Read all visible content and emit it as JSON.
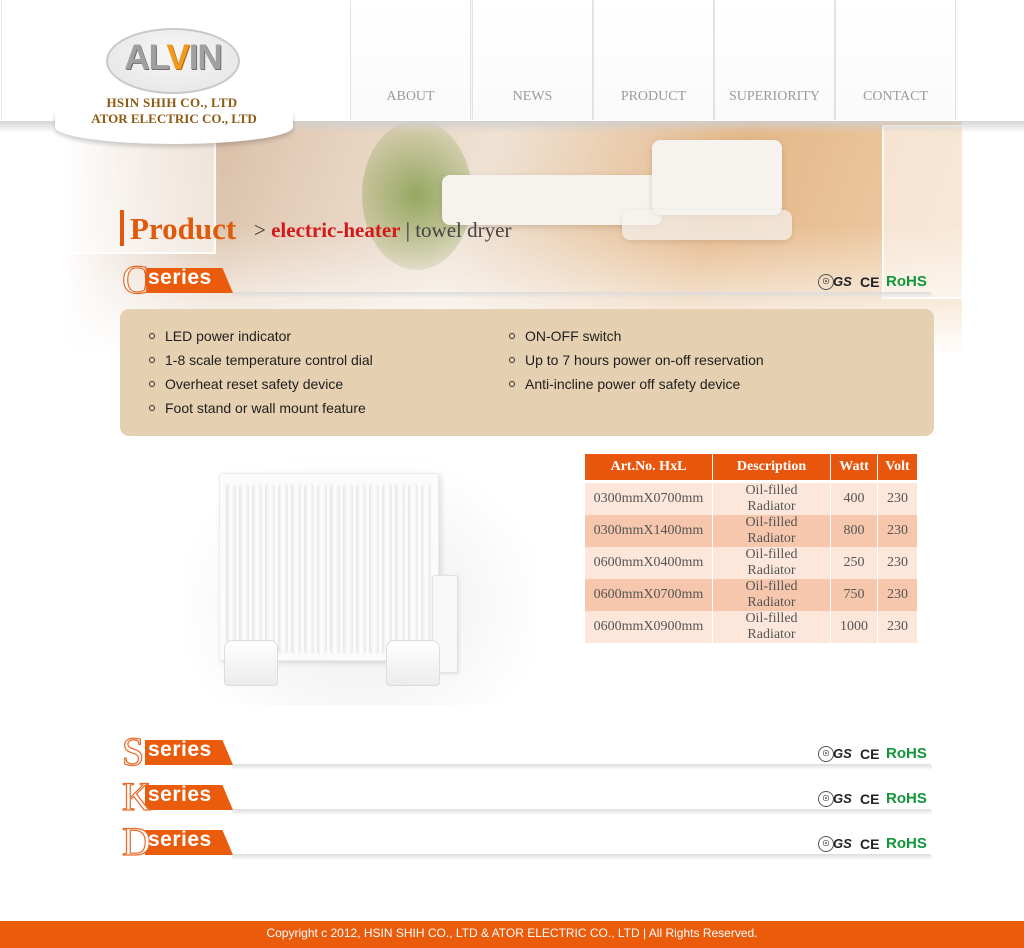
{
  "logo": {
    "brand": "ALVIN",
    "brand_pre": "AL",
    "brand_v": "V",
    "brand_post": "IN",
    "company1": "HSIN SHIH CO., LTD",
    "company2": "ATOR ELECTRIC CO., LTD"
  },
  "nav": [
    "ABOUT",
    "NEWS",
    "PRODUCT",
    "SUPERIORITY",
    "CONTACT"
  ],
  "heading": {
    "title": "Product",
    "separator": ">",
    "active": "electric-heater",
    "divider": "|",
    "other": "towel dryer"
  },
  "series": [
    {
      "letter": "C",
      "word": "series"
    },
    {
      "letter": "S",
      "word": "series"
    },
    {
      "letter": "K",
      "word": "series"
    },
    {
      "letter": "D",
      "word": "series"
    }
  ],
  "certs": {
    "gs_mark": "GS",
    "ce": "CE",
    "rohs": "RoHS"
  },
  "features": {
    "left": [
      "LED power indicator",
      "1-8 scale temperature control dial",
      "Overheat reset safety device",
      "Foot stand or wall mount feature"
    ],
    "right": [
      "ON-OFF switch",
      "Up to 7 hours power on-off reservation",
      "Anti-incline power off safety device"
    ]
  },
  "table": {
    "headers": [
      "Art.No. HxL",
      "Description",
      "Watt",
      "Volt"
    ],
    "rows": [
      [
        "0300mmX0700mm",
        "Oil-filled Radiator",
        "400",
        "230"
      ],
      [
        "0300mmX1400mm",
        "Oil-filled Radiator",
        "800",
        "230"
      ],
      [
        "0600mmX0400mm",
        "Oil-filled Radiator",
        "250",
        "230"
      ],
      [
        "0600mmX0700mm",
        "Oil-filled Radiator",
        "750",
        "230"
      ],
      [
        "0600mmX0900mm",
        "Oil-filled Radiator",
        "1000",
        "230"
      ]
    ]
  },
  "footer": "Copyright c 2012, HSIN SHIH CO., LTD & ATOR ELECTRIC CO., LTD | All Rights Reserved.",
  "colors": {
    "accent": "#ea5b0c",
    "heading": "#e05a0c",
    "active_link": "#d4181b",
    "panel": "#e5d0b1",
    "rohs": "#12963a"
  }
}
